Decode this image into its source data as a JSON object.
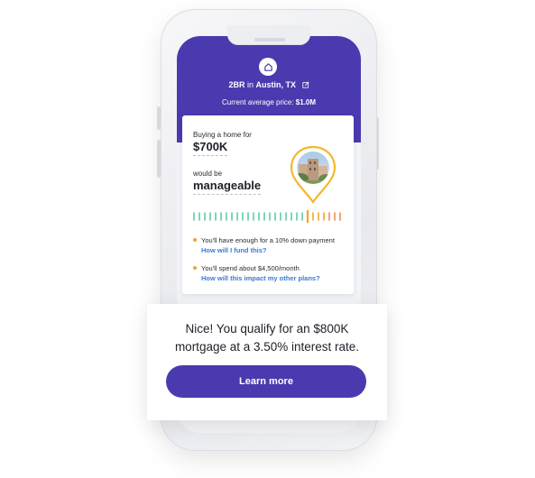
{
  "header": {
    "bedrooms": "2BR",
    "connector": "in",
    "location": "Austin, TX",
    "avg_price_label": "Current average price:",
    "avg_price_value": "$1.0M"
  },
  "card": {
    "buying_label": "Buying a home for",
    "price": "$700K",
    "would_be_label": "would be",
    "assessment": "manageable",
    "gauge_position": 0.78,
    "bullets": [
      {
        "text": "You'll have enough for a 10% down payment",
        "link": "How will I fund this?"
      },
      {
        "text": "You'll spend about $4,500/month",
        "link": "How will this impact my other plans?"
      }
    ]
  },
  "overlay": {
    "line1": "Nice! You qualify for an $800K",
    "line2": "mortgage at a 3.50% interest rate.",
    "button_label": "Learn more"
  },
  "colors": {
    "brand": "#4a3aaf",
    "accent": "#f2a623",
    "link": "#3a7ad6",
    "gauge_green": "#5fcba7"
  },
  "icons": {
    "home": "home-icon",
    "edit": "edit-icon",
    "pin": "location-pin-icon"
  }
}
